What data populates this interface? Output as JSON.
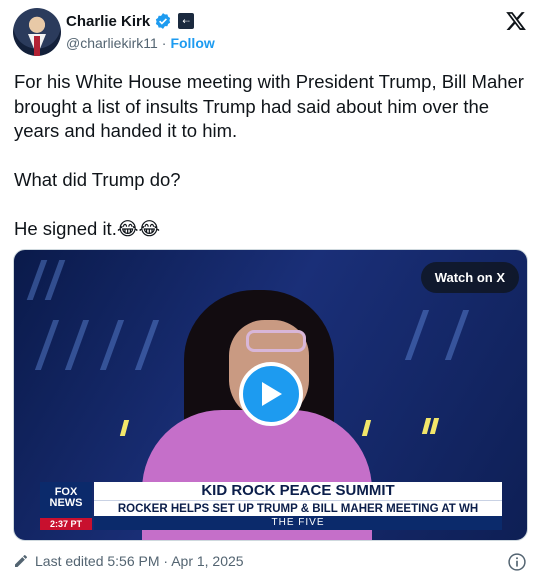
{
  "header": {
    "name": "Charlie Kirk",
    "handle": "@charliekirk11",
    "separator": "·",
    "follow_label": "Follow",
    "verified_icon": "verified-badge-icon",
    "affiliation_icon": "affiliation-badge-icon",
    "platform_icon": "x-logo-icon"
  },
  "tweet": {
    "text": "For his White House meeting with President Trump, Bill Maher brought a list of insults Trump had said about him over the years and handed it to him.\n\nWhat did Trump do?\n\nHe signed it.😂😂"
  },
  "media": {
    "watch_label": "Watch on X",
    "play_icon": "play-icon",
    "lower_third": {
      "network_line1": "FOX",
      "network_line2": "NEWS",
      "time": "2:37 PT",
      "title": "KID ROCK PEACE SUMMIT",
      "subtitle": "ROCKER HELPS SET UP TRUMP & BILL MAHER MEETING AT WH",
      "show": "THE FIVE"
    }
  },
  "footer": {
    "edit_icon": "pencil-icon",
    "edited_text": "Last edited 5:56 PM · Apr 1, 2025",
    "info_icon": "info-icon"
  },
  "colors": {
    "accent": "#1d9bf0",
    "text": "#0f1419",
    "muted": "#536471"
  }
}
